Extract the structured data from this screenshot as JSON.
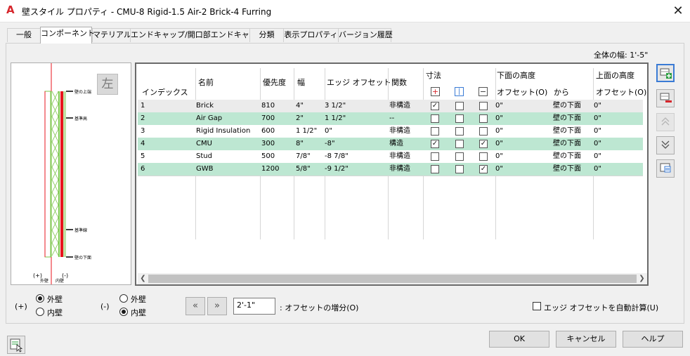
{
  "window": {
    "logo_letter": "A",
    "title": "壁スタイル プロパティ - CMU-8 Rigid-1.5 Air-2 Brick-4 Furring",
    "close_glyph": "✕"
  },
  "tabs": [
    {
      "label": "一般"
    },
    {
      "label": "コンポーネント"
    },
    {
      "label": "マテリアル"
    },
    {
      "label": "エンドキャップ/開口部エンドキャップ"
    },
    {
      "label": "分類"
    },
    {
      "label": "表示プロパティ"
    },
    {
      "label": "バージョン履歴"
    }
  ],
  "active_tab": "コンポーネント",
  "total_width": "全体の幅: 1'-5\"",
  "preview": {
    "side_button_label": "左",
    "labels": {
      "top_of_wall": "壁の上端",
      "baseline": "基準線",
      "base_height": "基準高",
      "bottom_of_wall": "壁の下面",
      "exterior_sign": "(+)",
      "exterior": "外壁",
      "interior_sign": "(-)",
      "interior": "内壁"
    }
  },
  "grid": {
    "headers": {
      "index": "インデックス",
      "name": "名前",
      "priority": "優先度",
      "width": "幅",
      "edge_offset": "エッジ オフセット",
      "function": "関数",
      "dimension": "寸法",
      "bottom_height": "下面の高度",
      "bottom_offset": "オフセット(O)",
      "bottom_from": "から",
      "top_height": "上面の高度",
      "top_offset": "オフセット(O)"
    },
    "rows": [
      {
        "index": "1",
        "name": "Brick",
        "priority": "810",
        "width": "4\"",
        "edge_offset": "3 1/2\"",
        "function": "非構造",
        "dim1": "✓",
        "dim2": "",
        "dim3": "",
        "bottom_offset": "0\"",
        "bottom_from": "壁の下面",
        "top_offset": "0\""
      },
      {
        "index": "2",
        "name": "Air Gap",
        "priority": "700",
        "width": "2\"",
        "edge_offset": "1 1/2\"",
        "function": "--",
        "dim1": "",
        "dim2": "",
        "dim3": "",
        "bottom_offset": "0\"",
        "bottom_from": "壁の下面",
        "top_offset": "0\""
      },
      {
        "index": "3",
        "name": "Rigid Insulation",
        "priority": "600",
        "width": "1 1/2\"",
        "edge_offset": "0\"",
        "function": "非構造",
        "dim1": "",
        "dim2": "",
        "dim3": "",
        "bottom_offset": "0\"",
        "bottom_from": "壁の下面",
        "top_offset": "0\""
      },
      {
        "index": "4",
        "name": "CMU",
        "priority": "300",
        "width": "8\"",
        "edge_offset": "-8\"",
        "function": "構造",
        "dim1": "✓",
        "dim2": "",
        "dim3": "✓",
        "bottom_offset": "0\"",
        "bottom_from": "壁の下面",
        "top_offset": "0\""
      },
      {
        "index": "5",
        "name": "Stud",
        "priority": "500",
        "width": "7/8\"",
        "edge_offset": "-8 7/8\"",
        "function": "非構造",
        "dim1": "",
        "dim2": "",
        "dim3": "",
        "bottom_offset": "0\"",
        "bottom_from": "壁の下面",
        "top_offset": "0\""
      },
      {
        "index": "6",
        "name": "GWB",
        "priority": "1200",
        "width": "5/8\"",
        "edge_offset": "-9 1/2\"",
        "function": "非構造",
        "dim1": "",
        "dim2": "",
        "dim3": "✓",
        "bottom_offset": "0\"",
        "bottom_from": "壁の下面",
        "top_offset": "0\""
      }
    ]
  },
  "exterior_group": {
    "sign": "(+)",
    "options": [
      "外壁",
      "内壁"
    ],
    "selected": "外壁"
  },
  "interior_group": {
    "sign": "(-)",
    "options": [
      "外壁",
      "内壁"
    ],
    "selected": "内壁"
  },
  "offset_increment": {
    "value": "2'-1\"",
    "label": ": オフセットの増分(O)"
  },
  "auto_edge_offset": {
    "label": "エッジ オフセットを自動計算(U)",
    "checked": false
  },
  "buttons": {
    "ok": "OK",
    "cancel": "キャンセル",
    "help": "ヘルプ"
  },
  "colors": {
    "row_highlight": "#bde7d2",
    "wall_red": "#e8141c",
    "wall_green": "#7cc44a"
  }
}
